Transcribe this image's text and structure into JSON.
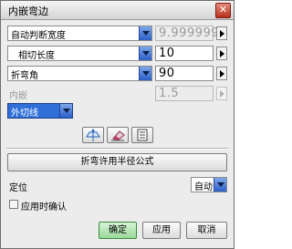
{
  "window": {
    "title": "内嵌弯边",
    "close_glyph": "✕"
  },
  "rows": [
    {
      "selector": "自动判断宽度",
      "value": "9.999999",
      "value_disabled": true
    },
    {
      "selector": "相切长度",
      "value": "10",
      "value_disabled": false
    },
    {
      "selector": "折弯角",
      "value": "90",
      "value_disabled": false
    }
  ],
  "inner": {
    "label": "内嵌",
    "value": "1.5"
  },
  "tangent_select": {
    "value": "外切线"
  },
  "icons": [
    "flip-direction-icon",
    "eraser-icon",
    "list-icon"
  ],
  "radius_button": {
    "label": "折弯许用半径公式"
  },
  "position": {
    "label": "定位",
    "value": "自动"
  },
  "confirm_on_apply": {
    "label": "应用时确认",
    "checked": false
  },
  "footer": {
    "ok": "确定",
    "apply": "应用",
    "cancel": "取消"
  }
}
